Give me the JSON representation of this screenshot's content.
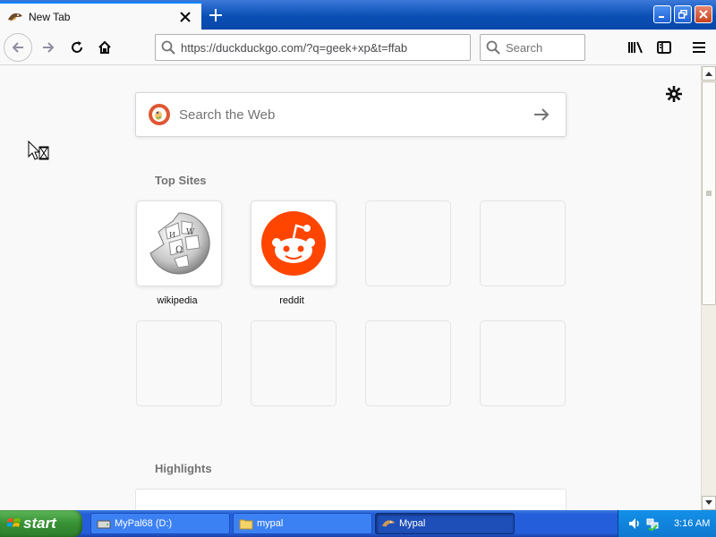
{
  "tab": {
    "title": "New Tab"
  },
  "toolbar": {
    "url": "https://duckduckgo.com/?q=geek+xp&t=ffab",
    "search_placeholder": "Search"
  },
  "content": {
    "web_search_placeholder": "Search the Web",
    "top_sites_heading": "Top Sites",
    "highlights_heading": "Highlights",
    "top_sites": [
      {
        "label": "wikipedia",
        "icon": "wikipedia-globe-icon"
      },
      {
        "label": "reddit",
        "icon": "reddit-alien-icon"
      },
      {
        "label": "",
        "icon": ""
      },
      {
        "label": "",
        "icon": ""
      },
      {
        "label": "",
        "icon": ""
      },
      {
        "label": "",
        "icon": ""
      },
      {
        "label": "",
        "icon": ""
      },
      {
        "label": "",
        "icon": ""
      }
    ]
  },
  "taskbar": {
    "start_label": "start",
    "tasks": [
      {
        "label": "MyPal68 (D:)",
        "icon": "drive-icon"
      },
      {
        "label": "mypal",
        "icon": "folder-icon"
      },
      {
        "label": "Mypal",
        "icon": "mypal-browser-icon"
      }
    ],
    "clock": "3:16 AM"
  },
  "colors": {
    "accent": "#0a84ff",
    "xp_taskbar": "#245edb",
    "xp_start": "#379135",
    "reddit": "#ff4500",
    "duckduckgo": "#de5833"
  }
}
